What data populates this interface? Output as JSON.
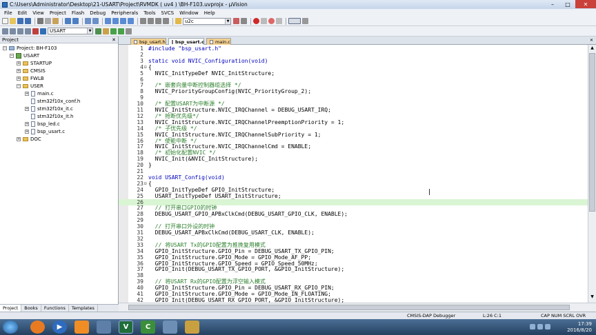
{
  "window": {
    "title": "C:\\Users\\Administrator\\Desktop\\21-USART\\Project\\RVMDK ( uv4 ) \\BH-F103.uvprojx - µVision",
    "min": "–",
    "max": "□",
    "close": "✕"
  },
  "menu": [
    "File",
    "Edit",
    "View",
    "Project",
    "Flash",
    "Debug",
    "Peripherals",
    "Tools",
    "SVCS",
    "Window",
    "Help"
  ],
  "toolbar": {
    "find_value": "u2c",
    "target_value": "USART"
  },
  "project_panel": {
    "header": "Project",
    "close": "✕",
    "tree": [
      {
        "label": "Project: BH-F103",
        "level": 0,
        "kind": "root",
        "expander": "−"
      },
      {
        "label": "USART",
        "level": 1,
        "kind": "target",
        "expander": "−"
      },
      {
        "label": "STARTUP",
        "level": 2,
        "kind": "folder",
        "expander": "+"
      },
      {
        "label": "CMSIS",
        "level": 2,
        "kind": "folder",
        "expander": "+"
      },
      {
        "label": "FWLB",
        "level": 2,
        "kind": "folder",
        "expander": "+"
      },
      {
        "label": "USER",
        "level": 2,
        "kind": "folder",
        "expander": "−"
      },
      {
        "label": "main.c",
        "level": 3,
        "kind": "file",
        "expander": "+"
      },
      {
        "label": "stm32f10x_conf.h",
        "level": 3,
        "kind": "file",
        "expander": ""
      },
      {
        "label": "stm32f10x_it.c",
        "level": 3,
        "kind": "file",
        "expander": "+"
      },
      {
        "label": "stm32f10x_it.h",
        "level": 3,
        "kind": "file",
        "expander": ""
      },
      {
        "label": "bsp_led.c",
        "level": 3,
        "kind": "file",
        "expander": "+"
      },
      {
        "label": "bsp_usart.c",
        "level": 3,
        "kind": "file",
        "expander": "+"
      },
      {
        "label": "DOC",
        "level": 2,
        "kind": "folder",
        "expander": "+"
      }
    ],
    "tabs": [
      "Project",
      "Books",
      "Functions",
      "Templates"
    ]
  },
  "editor_tabs": [
    {
      "label": "bsp_usart.h",
      "active": false
    },
    {
      "label": "bsp_usart.c",
      "active": true
    },
    {
      "label": "main.c",
      "active": false
    }
  ],
  "code_lines": [
    {
      "n": "1",
      "fold": "",
      "text": "#include \"bsp_usart.h\"",
      "hl": false
    },
    {
      "n": "2",
      "fold": "",
      "text": "",
      "hl": false
    },
    {
      "n": "3",
      "fold": "",
      "text": "static void NVIC_Configuration(void)",
      "hl": false
    },
    {
      "n": "4",
      "fold": "⊟",
      "text": "{",
      "hl": false
    },
    {
      "n": "5",
      "fold": "",
      "text": "  NVIC_InitTypeDef NVIC_InitStructure;",
      "hl": false
    },
    {
      "n": "6",
      "fold": "",
      "text": "",
      "hl": false
    },
    {
      "n": "7",
      "fold": "",
      "text": "  /* 嵌套向量中断控制器组选择 */",
      "hl": false,
      "comment": true
    },
    {
      "n": "8",
      "fold": "",
      "text": "  NVIC_PriorityGroupConfig(NVIC_PriorityGroup_2);",
      "hl": false
    },
    {
      "n": "9",
      "fold": "",
      "text": "",
      "hl": false
    },
    {
      "n": "10",
      "fold": "",
      "text": "  /* 配置USART为中断源 */",
      "hl": false,
      "comment": true
    },
    {
      "n": "11",
      "fold": "",
      "text": "  NVIC_InitStructure.NVIC_IRQChannel = DEBUG_USART_IRQ;",
      "hl": false
    },
    {
      "n": "12",
      "fold": "",
      "text": "  /* 抢断优先级*/",
      "hl": false,
      "comment": true
    },
    {
      "n": "13",
      "fold": "",
      "text": "  NVIC_InitStructure.NVIC_IRQChannelPreemptionPriority = 1;",
      "hl": false
    },
    {
      "n": "14",
      "fold": "",
      "text": "  /* 子优先级 */",
      "hl": false,
      "comment": true
    },
    {
      "n": "15",
      "fold": "",
      "text": "  NVIC_InitStructure.NVIC_IRQChannelSubPriority = 1;",
      "hl": false
    },
    {
      "n": "16",
      "fold": "",
      "text": "  /* 使能中断 */",
      "hl": false,
      "comment": true
    },
    {
      "n": "17",
      "fold": "",
      "text": "  NVIC_InitStructure.NVIC_IRQChannelCmd = ENABLE;",
      "hl": false
    },
    {
      "n": "18",
      "fold": "",
      "text": "  /* 初始化配置NVIC */",
      "hl": false,
      "comment": true
    },
    {
      "n": "19",
      "fold": "",
      "text": "  NVIC_Init(&NVIC_InitStructure);",
      "hl": false
    },
    {
      "n": "20",
      "fold": "",
      "text": "}",
      "hl": false
    },
    {
      "n": "21",
      "fold": "",
      "text": "",
      "hl": false
    },
    {
      "n": "22",
      "fold": "",
      "text": "void USART_Config(void)",
      "hl": false
    },
    {
      "n": "23",
      "fold": "⊟",
      "text": "{",
      "hl": false
    },
    {
      "n": "24",
      "fold": "",
      "text": "  GPIO_InitTypeDef GPIO_InitStructure;",
      "hl": false
    },
    {
      "n": "25",
      "fold": "",
      "text": "  USART_InitTypeDef USART_InitStructure;",
      "hl": false
    },
    {
      "n": "26",
      "fold": "",
      "text": "",
      "hl": true
    },
    {
      "n": "27",
      "fold": "",
      "text": "  // 打开串口GPIO的时钟",
      "hl": false,
      "comment": true
    },
    {
      "n": "28",
      "fold": "",
      "text": "  DEBUG_USART_GPIO_APBxClkCmd(DEBUG_USART_GPIO_CLK, ENABLE);",
      "hl": false
    },
    {
      "n": "29",
      "fold": "",
      "text": "",
      "hl": false
    },
    {
      "n": "30",
      "fold": "",
      "text": "  // 打开串口外设的时钟",
      "hl": false,
      "comment": true
    },
    {
      "n": "31",
      "fold": "",
      "text": "  DEBUG_USART_APBxClkCmd(DEBUG_USART_CLK, ENABLE);",
      "hl": false
    },
    {
      "n": "32",
      "fold": "",
      "text": "",
      "hl": false
    },
    {
      "n": "33",
      "fold": "",
      "text": "  // 将USART Tx的GPIO配置为推挽复用模式",
      "hl": false,
      "comment": true
    },
    {
      "n": "34",
      "fold": "",
      "text": "  GPIO_InitStructure.GPIO_Pin = DEBUG_USART_TX_GPIO_PIN;",
      "hl": false
    },
    {
      "n": "35",
      "fold": "",
      "text": "  GPIO_InitStructure.GPIO_Mode = GPIO_Mode_AF_PP;",
      "hl": false
    },
    {
      "n": "36",
      "fold": "",
      "text": "  GPIO_InitStructure.GPIO_Speed = GPIO_Speed_50MHz;",
      "hl": false
    },
    {
      "n": "37",
      "fold": "",
      "text": "  GPIO_Init(DEBUG_USART_TX_GPIO_PORT, &GPIO_InitStructure);",
      "hl": false
    },
    {
      "n": "38",
      "fold": "",
      "text": "",
      "hl": false
    },
    {
      "n": "39",
      "fold": "",
      "text": "  // 将USART Rx的GPIO配置为浮空输入模式",
      "hl": false,
      "comment": true
    },
    {
      "n": "40",
      "fold": "",
      "text": "  GPIO_InitStructure.GPIO_Pin = DEBUG_USART_RX_GPIO_PIN;",
      "hl": false
    },
    {
      "n": "41",
      "fold": "",
      "text": "  GPIO_InitStructure.GPIO_Mode = GPIO_Mode_IN_FLOATING;",
      "hl": false
    },
    {
      "n": "42",
      "fold": "",
      "text": "  GPIO_Init(DEBUG_USART_RX_GPIO_PORT, &GPIO_InitStructure);",
      "hl": false
    }
  ],
  "status": {
    "debugger": "CMSIS-DAP Debugger",
    "position": "L:26 C:1",
    "flags": "CAP  NUM  SCRL  OVR  R/W"
  },
  "taskbar": {
    "time": "17:39",
    "date": "2016/8/20"
  },
  "colors": {
    "comment": "#2b7f2b",
    "keyword": "#0000c0",
    "current_line": "#d9f5d3",
    "active_tab": "#ffffff",
    "inactive_tab": "#f2cf8f"
  }
}
